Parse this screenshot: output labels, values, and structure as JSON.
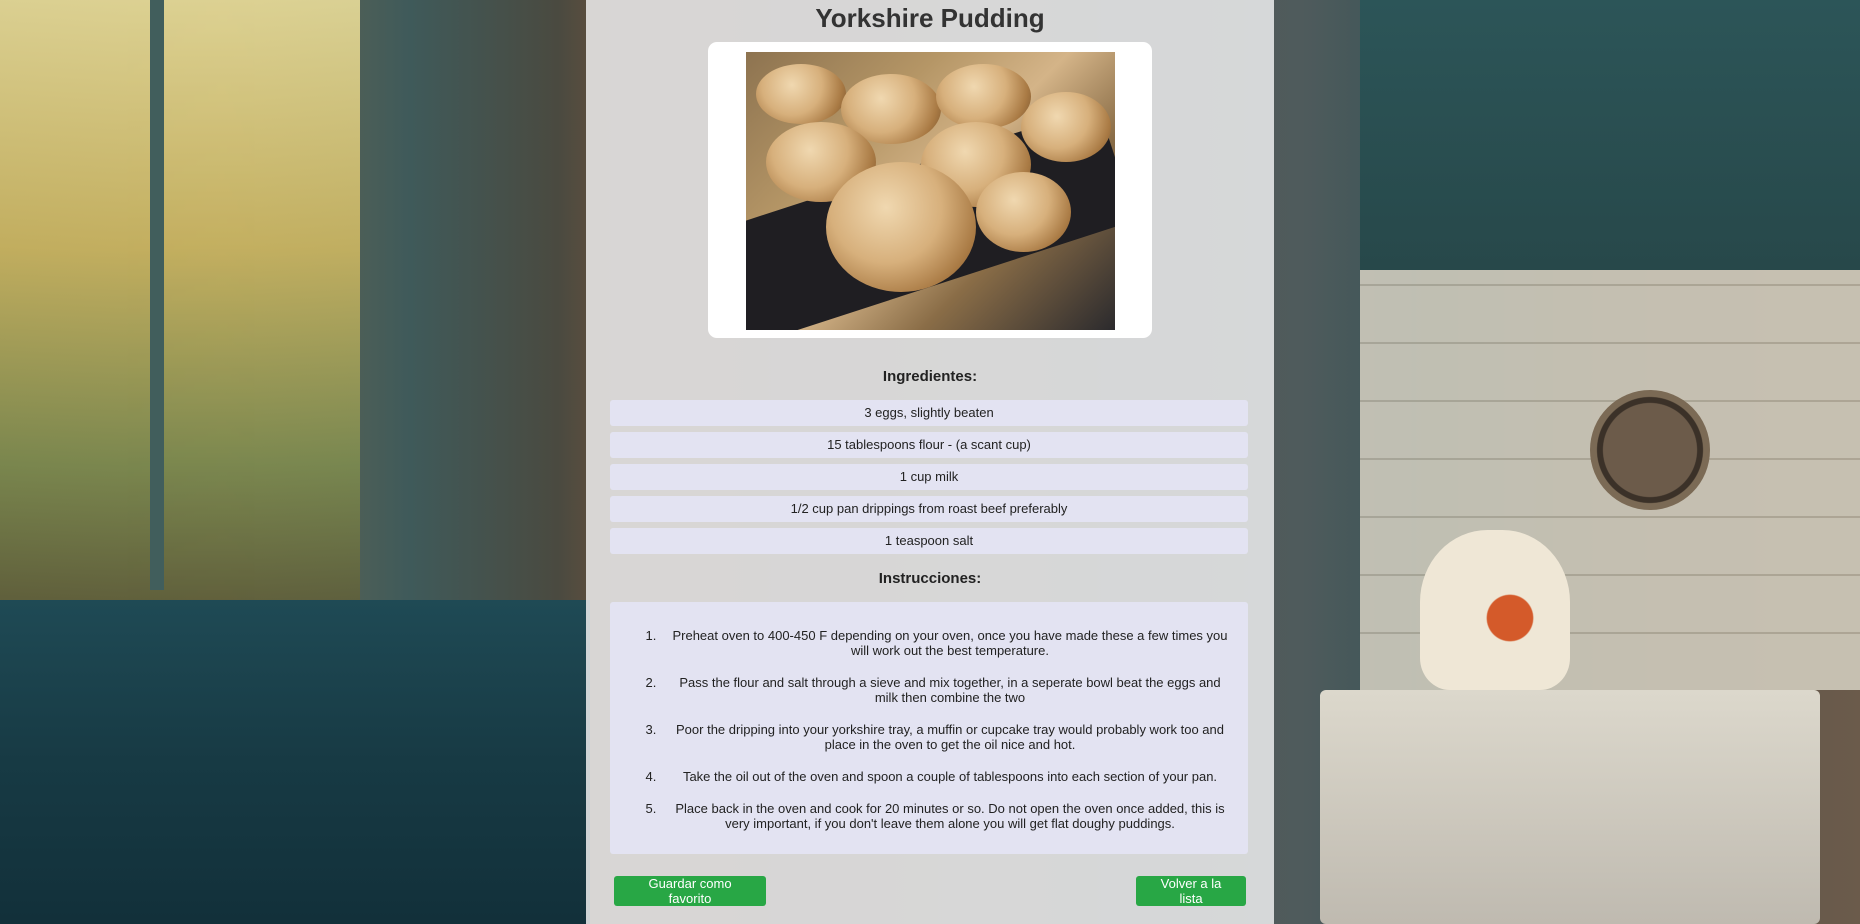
{
  "recipe": {
    "title": "Yorkshire Pudding",
    "ingredients_heading": "Ingredientes:",
    "ingredients": [
      "3 eggs, slightly beaten",
      "15 tablespoons flour - (a scant cup)",
      "1 cup milk",
      "1/2 cup pan drippings from roast beef preferably",
      "1 teaspoon salt"
    ],
    "instructions_heading": "Instrucciones:",
    "instructions": [
      "Preheat oven to 400-450 F depending on your oven, once you have made these a few times you will work out the best temperature.",
      "Pass the flour and salt through a sieve and mix together, in a seperate bowl beat the eggs and milk then combine the two",
      "Poor the dripping into your yorkshire tray, a muffin or cupcake tray would probably work too and place in the oven to get the oil nice and hot.",
      "Take the oil out of the oven and spoon a couple of tablespoons into each section of your pan.",
      "Place back in the oven and cook for 20 minutes or so. Do not open the oven once added, this is very important, if you don't leave them alone you will get flat doughy puddings."
    ]
  },
  "actions": {
    "favorite_label": "Guardar como favorito",
    "back_label": "Volver a la lista"
  },
  "colors": {
    "button_green": "#28a745",
    "list_item_bg": "#e3e3f2"
  }
}
